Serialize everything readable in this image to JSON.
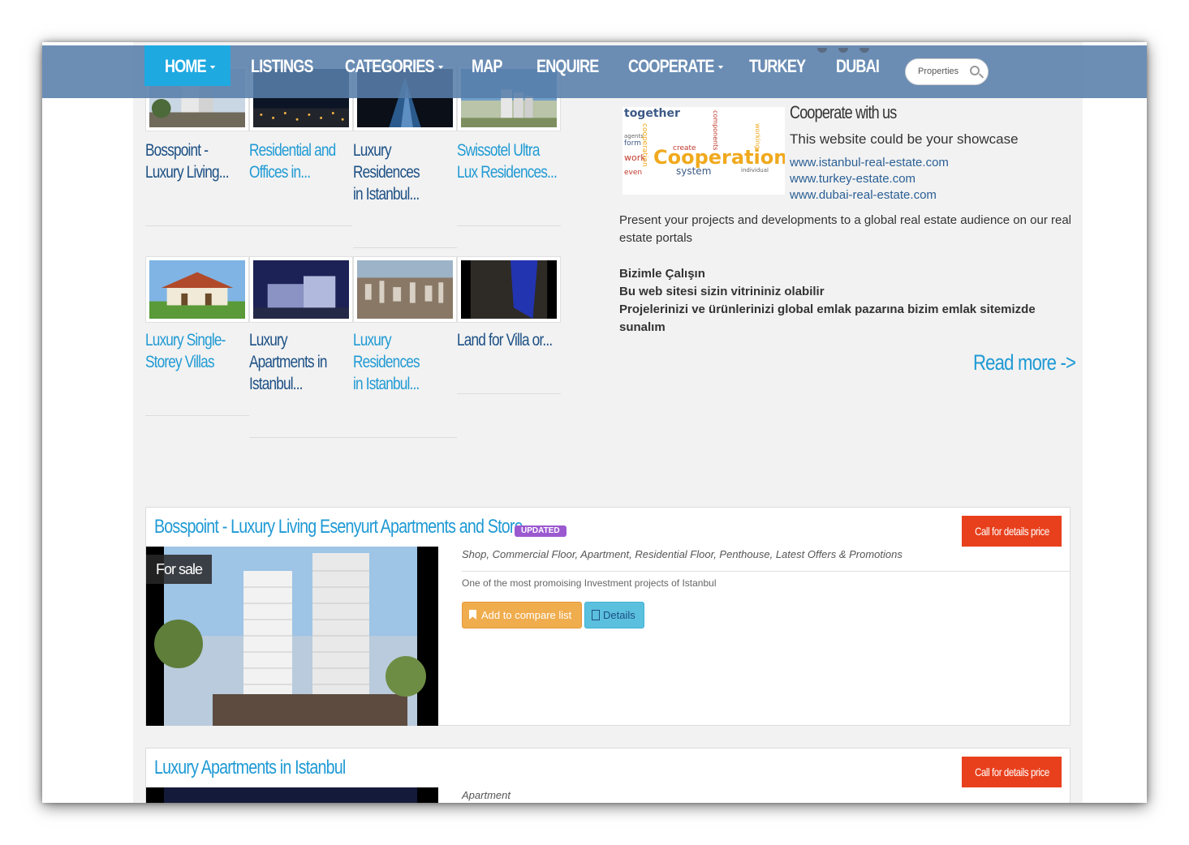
{
  "nav": {
    "items": [
      {
        "label": "HOME",
        "caret": true
      },
      {
        "label": "LISTINGS",
        "caret": false
      },
      {
        "label": "CATEGORIES",
        "caret": true
      },
      {
        "label": "MAP",
        "caret": false
      },
      {
        "label": "ENQUIRE",
        "caret": false
      },
      {
        "label": "COOPERATE",
        "caret": true
      },
      {
        "label": "TURKEY",
        "caret": false
      },
      {
        "label": "DUBAI",
        "caret": false
      }
    ],
    "search_placeholder": "Properties"
  },
  "thumbs": [
    {
      "title": "Bosspoint - Luxury Living..."
    },
    {
      "title": "Residential and Offices in..."
    },
    {
      "title": "Luxury Residences in Istanbul..."
    },
    {
      "title": "Swissotel Ultra Lux Residences..."
    },
    {
      "title": "Luxury Single-Storey Villas"
    },
    {
      "title": "Luxury Apartments in Istanbul..."
    },
    {
      "title": "Luxury Residences in Istanbul..."
    },
    {
      "title": "Land for Villa or..."
    }
  ],
  "cooperate": {
    "image_words": [
      "together",
      "Cooperation",
      "system",
      "create",
      "form",
      "agents",
      "work",
      "even",
      "cooperation",
      "working",
      "individual",
      "components"
    ],
    "title": "Cooperate with us",
    "subtitle": "This website could be your showcase",
    "links": [
      "www.istanbul-real-estate.com",
      "www.turkey-estate.com",
      "www.dubai-real-estate.com"
    ],
    "text": "Present your projects and developments to a global real estate audience on our real estate portals",
    "tr_1": "Bizimle Çalışın",
    "tr_2": "Bu web sitesi sizin vitrininiz olabilir",
    "tr_3": "Projelerinizi ve ürünlerinizi global emlak pazarına bizim emlak sitemizde sunalım",
    "read_more": "Read more ->"
  },
  "listings": [
    {
      "title": "Bosspoint - Luxury Living Esenyurt Apartments and Store",
      "badge": "UPDATED",
      "price": "Call for details price",
      "status": "For sale",
      "categories": "Shop, Commercial Floor, Apartment, Residential Floor, Penthouse, Latest Offers & Promotions",
      "description": "One of the most promoising Investment projects of Istanbul",
      "compare_label": "Add to compare list",
      "details_label": "Details"
    },
    {
      "title": "Luxury Apartments in Istanbul",
      "price": "Call for details price",
      "categories": "Apartment"
    }
  ],
  "colors": {
    "nav_bg": "#587eab",
    "nav_active": "#1ea9e1",
    "link_blue": "#1f9ad4",
    "title_dark": "#1b4f84",
    "price_red": "#e8401c",
    "badge_purple": "#9b59d0",
    "compare_orange": "#f0ad4e",
    "details_cyan": "#5bc0de"
  }
}
